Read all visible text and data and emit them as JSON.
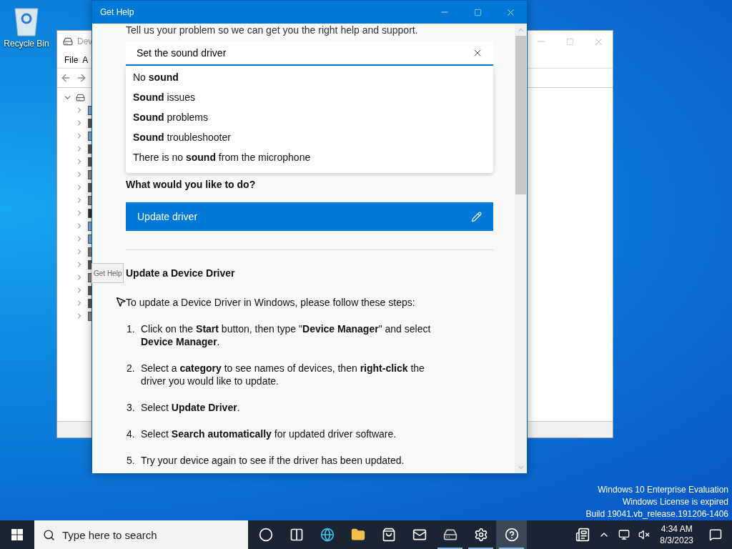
{
  "desktop": {
    "icons": [
      {
        "label": "Recycle Bin"
      }
    ],
    "os_notice": [
      "Windows 10 Enterprise Evaluation",
      "Windows License is expired",
      "Build 19041.vb_release.191206-1406"
    ]
  },
  "device_manager": {
    "title": "Dev",
    "menu": [
      "File",
      "A"
    ],
    "tree": {
      "expanded": true,
      "children": [
        {
          "expanded": false
        },
        {
          "expanded": false
        },
        {
          "expanded": false
        },
        {
          "expanded": false
        },
        {
          "expanded": false
        },
        {
          "expanded": false
        },
        {
          "expanded": false
        },
        {
          "expanded": false
        },
        {
          "expanded": false
        },
        {
          "expanded": false
        },
        {
          "expanded": false
        },
        {
          "expanded": false
        },
        {
          "expanded": false
        },
        {
          "expanded": false
        },
        {
          "expanded": false
        },
        {
          "expanded": false
        },
        {
          "expanded": false
        }
      ]
    }
  },
  "help_window": {
    "title": "Get Help",
    "intro": "Tell us your problem so we can get you the right help and support.",
    "search": {
      "value": "Set the sound driver"
    },
    "suggestions": [
      "No **sound**",
      "**Sound** issues",
      "**Sound** problems",
      "**Sound** troubleshooter",
      "There is no **sound** from the microphone"
    ],
    "question": "What would you like to do?",
    "action_button": {
      "label": "Update driver"
    },
    "article": {
      "heading": "Update a Device Driver",
      "intro": "To update a Device Driver in Windows, please follow these steps:",
      "steps": [
        {
          "number": "1.",
          "text": "Click on the **Start** button, then type \"**Device Manager**\" and select **Device Manager**."
        },
        {
          "number": "2.",
          "text": "Select a **category** to see names of devices, then **right-click** the driver you would like to update."
        },
        {
          "number": "3.",
          "text": "Select **Update Driver**."
        },
        {
          "number": "4.",
          "text": "Select **Search automatically** for updated driver software."
        },
        {
          "number": "5.",
          "text": "Try your device again to see if the driver has been updated."
        }
      ]
    }
  },
  "tooltip": {
    "text": "Get Help"
  },
  "taskbar": {
    "search": {
      "placeholder": "Type here to search"
    },
    "apps": [
      {
        "kind": "cortana",
        "running": false,
        "selected": false
      },
      {
        "kind": "taskview",
        "running": false,
        "selected": false
      },
      {
        "kind": "browser",
        "running": false,
        "selected": false
      },
      {
        "kind": "folder",
        "running": false,
        "selected": false
      },
      {
        "kind": "store",
        "running": false,
        "selected": false
      },
      {
        "kind": "mail",
        "running": false,
        "selected": false
      },
      {
        "kind": "devices",
        "running": true,
        "selected": false
      },
      {
        "kind": "settings",
        "running": true,
        "selected": false
      },
      {
        "kind": "help",
        "running": true,
        "selected": true
      }
    ],
    "clock": {
      "time": "4:34 AM",
      "date": "8/3/2023"
    }
  }
}
